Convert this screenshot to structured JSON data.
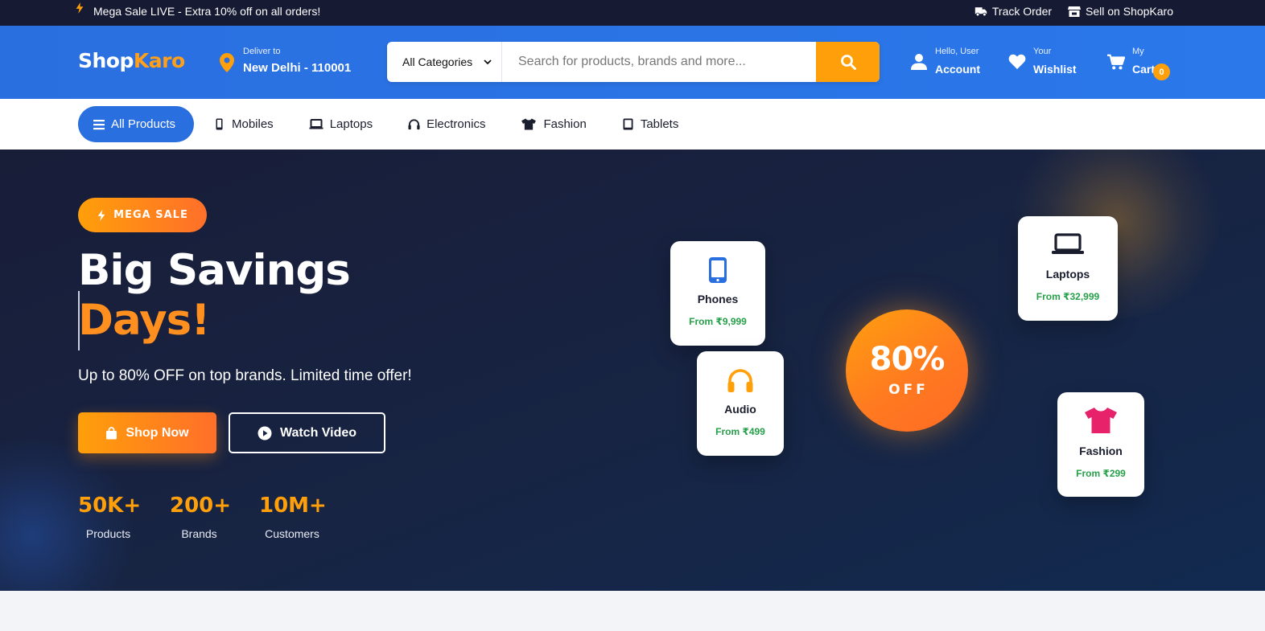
{
  "topbar": {
    "promo": "Mega Sale LIVE - Extra 10% off on all orders!",
    "track_order": "Track Order",
    "sell": "Sell on ShopKaro"
  },
  "header": {
    "logo_part1": "Shop",
    "logo_part2": "Karo",
    "deliver_label": "Deliver to",
    "deliver_location": "New Delhi - 110001",
    "category_select": "All Categories",
    "search_placeholder": "Search for products, brands and more...",
    "account_small": "Hello, User",
    "account_big": "Account",
    "wishlist_small": "Your",
    "wishlist_big": "Wishlist",
    "cart_small": "My",
    "cart_big": "Cart",
    "cart_count": "0"
  },
  "nav": {
    "items": [
      {
        "label": "All Products",
        "icon": "menu-icon"
      },
      {
        "label": "Mobiles",
        "icon": "mobile-icon"
      },
      {
        "label": "Laptops",
        "icon": "laptop-icon"
      },
      {
        "label": "Electronics",
        "icon": "headphones-icon"
      },
      {
        "label": "Fashion",
        "icon": "tshirt-icon"
      },
      {
        "label": "Tablets",
        "icon": "tablet-icon"
      }
    ]
  },
  "hero": {
    "badge": "MEGA SALE",
    "title_line1": "Big Savings",
    "title_line2": "Days!",
    "subtitle": "Up to 80% OFF on top brands. Limited time offer!",
    "shop_button": "Shop Now",
    "video_button": "Watch Video",
    "stats": [
      {
        "value": "50K+",
        "label": "Products"
      },
      {
        "value": "200+",
        "label": "Brands"
      },
      {
        "value": "10M+",
        "label": "Customers"
      }
    ],
    "cards": [
      {
        "title": "Phones",
        "price": "From ₹9,999"
      },
      {
        "title": "Laptops",
        "price": "From ₹32,999"
      },
      {
        "title": "Audio",
        "price": "From ₹499"
      },
      {
        "title": "Fashion",
        "price": "From ₹299"
      }
    ],
    "offer_percent": "80%",
    "offer_word": "OFF"
  },
  "colors": {
    "brand_blue": "#2a6fe0",
    "accent_orange": "#ff9f0a",
    "topbar_bg": "#161a33",
    "hero_bg": "#172443",
    "price_green": "#27a04a"
  }
}
